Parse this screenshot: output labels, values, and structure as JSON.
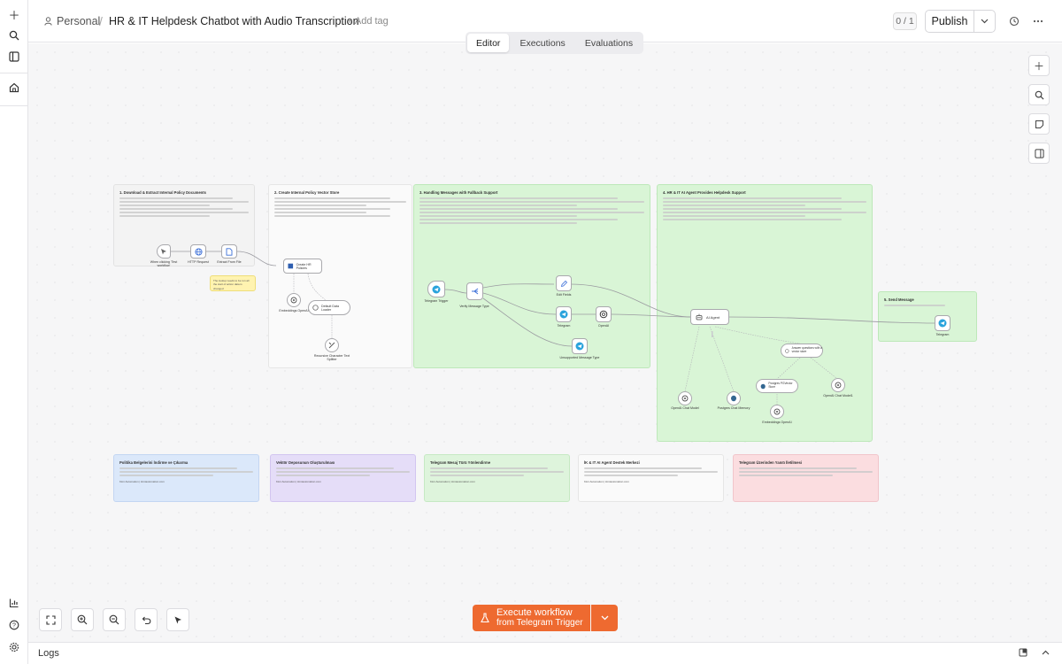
{
  "header": {
    "owner": "Personal",
    "separator": "/",
    "title": "HR & IT Helpdesk Chatbot with Audio Transcription",
    "add_tag": "+ Add tag",
    "version": "0 / 1",
    "publish": "Publish"
  },
  "tabs": [
    {
      "label": "Editor",
      "active": true
    },
    {
      "label": "Executions",
      "active": false
    },
    {
      "label": "Evaluations",
      "active": false
    }
  ],
  "notes": {
    "n1": {
      "title": "1. Download & Extract Internal Policy Documents"
    },
    "n2": {
      "title": "2. Create Internal Policy Vector Store"
    },
    "n3": {
      "title": "3. Handling Messages with Fallback Support"
    },
    "n4": {
      "title": "4. HR & IT AI Agent Provides Helpdesk Support"
    },
    "n5": {
      "title": "5. Send Message"
    },
    "tip": {
      "title": "The lookup needs to be run all the start of action data is changed"
    },
    "b1": {
      "title": "Politika Belgelerini İndirme ve Çıkarma",
      "footer": "Kimi Automation | kimiautomation.com"
    },
    "b2": {
      "title": "Vektör Deposunun Oluşturulması",
      "footer": "Kimi Automation | kimiautomation.com"
    },
    "b3": {
      "title": "Telegram Mesaj Türü Yönlendirme",
      "footer": "Kimi Automation | kimiautomation.com"
    },
    "b4": {
      "title": "İK & IT AI Agent Destek Merkezi",
      "footer": "Kimi Automation | kimiautomation.com"
    },
    "b5": {
      "title": "Telegram Üzerinden Yanıtı İletilmesi",
      "footer": ""
    }
  },
  "nodes": {
    "when_clicking": "When clicking 'Test workflow'",
    "http_request": "HTTP Request",
    "extract_from_file": "Extract From File",
    "create_hr_policies": "Create HR Policies",
    "embeddings_openai": "Embeddings OpenAI",
    "default_data_loader": "Default Data Loader",
    "recursive_splitter": "Recursive Character Text Splitter",
    "telegram_trigger": "Telegram Trigger",
    "verify_message_type": "Verify Message Type",
    "edit_fields": "Edit Fields",
    "telegram_get": "Telegram",
    "openai_transcribe": "OpenAI",
    "unsupported_message": "Unsupported Message Type",
    "ai_agent": "AI Agent",
    "answer_questions": "Answer questions with a vector store",
    "openai_chat_model": "OpenAI Chat Model",
    "postgres_memory": "Postgres Chat Memory",
    "postgres_pgvector": "Postgres PGVector Store",
    "embeddings_openai2": "Embeddings OpenAI",
    "openai_chat_model2": "OpenAI Chat Model1",
    "telegram_send": "Telegram"
  },
  "execute": {
    "line1": "Execute workflow",
    "line2": "from Telegram Trigger"
  },
  "logs": {
    "label": "Logs"
  },
  "icons": [
    "plus-icon",
    "search-icon",
    "panel-icon",
    "home-icon",
    "chart-icon",
    "help-icon",
    "settings-icon",
    "history-icon",
    "more-icon",
    "zoom-in-icon",
    "zoom-out-icon",
    "fit-view-icon",
    "undo-icon",
    "tidy-icon"
  ],
  "colors": {
    "accent": "#ee6a30",
    "green_note": "#d9f5d6",
    "blue_note": "#dbe8fa",
    "purple_note": "#e5ddf8",
    "pink_note": "#fbdde0"
  }
}
